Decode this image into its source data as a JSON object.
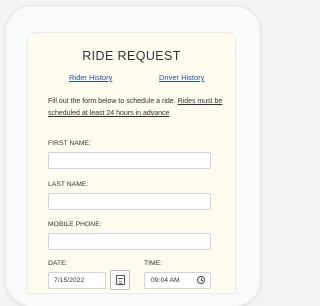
{
  "page": {
    "title": "RIDE REQUEST"
  },
  "nav": {
    "rider_history": "Rider History",
    "driver_history": "Driver History"
  },
  "intro": {
    "text": "Fill out the form below to schedule a ride.",
    "emphasis": "Rides must be scheduled at least 24 hours in advance"
  },
  "form": {
    "first_name_label": "FIRST NAME:",
    "last_name_label": "LAST NAME:",
    "mobile_phone_label": "MOBILE PHONE:",
    "date_label": "DATE:",
    "time_label": "TIME:",
    "date_value": "7/15/2022",
    "time_value": "09:04 AM"
  },
  "icons": {
    "calendar": "calendar-icon",
    "clock": "clock-icon"
  },
  "colors": {
    "card_background": "#fdfcee",
    "link": "#2a4d9b",
    "text": "#333333"
  }
}
